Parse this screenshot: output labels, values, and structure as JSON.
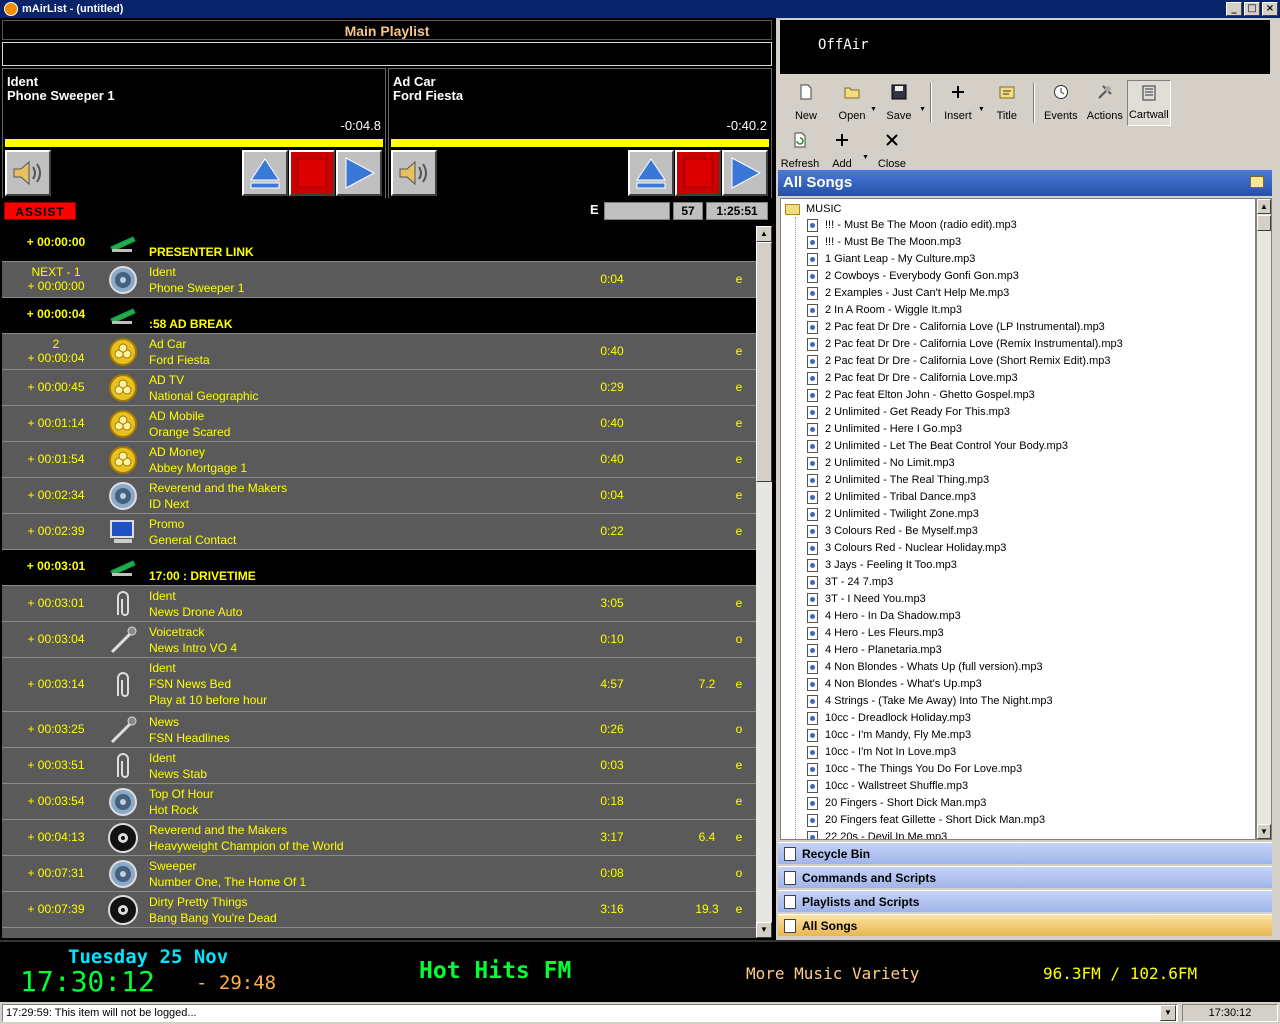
{
  "window": {
    "title": "mAirList - (untitled)"
  },
  "playlist": {
    "title": "Main Playlist"
  },
  "players": [
    {
      "line1": "Ident",
      "line2": "Phone Sweeper 1",
      "remaining": "-0:04.8",
      "progress": 1.0
    },
    {
      "line1": "Ad Car",
      "line2": "Ford Fiesta",
      "remaining": "-0:40.2",
      "progress": 1.0
    }
  ],
  "assist": {
    "label": "ASSIST",
    "e_label": "E",
    "count": "57",
    "duration": "1:25:51"
  },
  "rows": [
    {
      "type": "header",
      "time": "+ 00:00:00",
      "title": "PRESENTER LINK",
      "icon": "stapler-icon"
    },
    {
      "type": "item",
      "time1": "NEXT - 1",
      "time": "+ 00:00:00",
      "line1": "Ident",
      "line2": "Phone Sweeper 1",
      "dur": "0:04",
      "ramp": "",
      "flag": "e",
      "icon": "speaker-icon"
    },
    {
      "type": "header",
      "time": "+ 00:00:04",
      "title": ":58 AD BREAK",
      "icon": "stapler-icon"
    },
    {
      "type": "item",
      "time1": "2",
      "time": "+ 00:00:04",
      "line1": "Ad Car",
      "line2": "Ford Fiesta",
      "dur": "0:40",
      "ramp": "",
      "flag": "e",
      "icon": "coins-icon"
    },
    {
      "type": "item",
      "time": "+ 00:00:45",
      "line1": "AD TV",
      "line2": "National Geographic",
      "dur": "0:29",
      "ramp": "",
      "flag": "e",
      "icon": "coins-icon"
    },
    {
      "type": "item",
      "time": "+ 00:01:14",
      "line1": "AD Mobile",
      "line2": "Orange Scared",
      "dur": "0:40",
      "ramp": "",
      "flag": "e",
      "icon": "coins-icon"
    },
    {
      "type": "item",
      "time": "+ 00:01:54",
      "line1": "AD Money",
      "line2": "Abbey Mortgage 1",
      "dur": "0:40",
      "ramp": "",
      "flag": "e",
      "icon": "coins-icon"
    },
    {
      "type": "item",
      "time": "+ 00:02:34",
      "line1": "Reverend and the Makers",
      "line2": "ID Next",
      "dur": "0:04",
      "ramp": "",
      "flag": "e",
      "icon": "speaker-icon"
    },
    {
      "type": "item",
      "time": "+ 00:02:39",
      "line1": "Promo",
      "line2": "General Contact",
      "dur": "0:22",
      "ramp": "",
      "flag": "e",
      "icon": "monitor-icon"
    },
    {
      "type": "header",
      "time": "+ 00:03:01",
      "title": "17:00 : DRIVETIME",
      "icon": "stapler-icon"
    },
    {
      "type": "item",
      "time": "+ 00:03:01",
      "line1": "Ident",
      "line2": "News Drone Auto",
      "dur": "3:05",
      "ramp": "",
      "flag": "e",
      "icon": "paperclip-icon"
    },
    {
      "type": "item",
      "time": "+ 00:03:04",
      "line1": "Voicetrack",
      "line2": "News Intro VO 4",
      "dur": "0:10",
      "ramp": "",
      "flag": "o",
      "icon": "microphone-icon"
    },
    {
      "type": "item3",
      "time": "+ 00:03:14",
      "line1": "Ident",
      "line2": "FSN News Bed",
      "line3": "Play at 10 before hour",
      "dur": "4:57",
      "ramp": "7.2",
      "flag": "e",
      "icon": "paperclip-icon"
    },
    {
      "type": "item",
      "time": "+ 00:03:25",
      "line1": "News",
      "line2": "FSN Headlines",
      "dur": "0:26",
      "ramp": "",
      "flag": "o",
      "icon": "microphone-icon"
    },
    {
      "type": "item",
      "time": "+ 00:03:51",
      "line1": "Ident",
      "line2": "News Stab",
      "dur": "0:03",
      "ramp": "",
      "flag": "e",
      "icon": "paperclip-icon"
    },
    {
      "type": "item",
      "time": "+ 00:03:54",
      "line1": "Top Of Hour",
      "line2": "Hot Rock",
      "dur": "0:18",
      "ramp": "",
      "flag": "e",
      "icon": "speaker-icon"
    },
    {
      "type": "item",
      "time": "+ 00:04:13",
      "line1": "Reverend and the Makers",
      "line2": "Heavyweight Champion of the World",
      "dur": "3:17",
      "ramp": "6.4",
      "flag": "e",
      "icon": "cd-icon"
    },
    {
      "type": "item",
      "time": "+ 00:07:31",
      "line1": "Sweeper",
      "line2": "Number One, The Home Of 1",
      "dur": "0:08",
      "ramp": "",
      "flag": "o",
      "icon": "speaker-icon"
    },
    {
      "type": "item",
      "time": "+ 00:07:39",
      "line1": "Dirty Pretty Things",
      "line2": "Bang Bang You're Dead",
      "dur": "3:16",
      "ramp": "19.3",
      "flag": "e",
      "icon": "cd-icon"
    }
  ],
  "onair": {
    "label": "OffAir"
  },
  "toolbar1": [
    {
      "label": "New",
      "icon": "new-file-icon",
      "dropdown": false
    },
    {
      "label": "Open",
      "icon": "open-folder-icon",
      "dropdown": true
    },
    {
      "label": "Save",
      "icon": "save-disk-icon",
      "dropdown": true
    },
    {
      "label": "Insert",
      "icon": "insert-plus-icon",
      "dropdown": true
    },
    {
      "label": "Title",
      "icon": "title-icon",
      "dropdown": false
    },
    {
      "label": "Events",
      "icon": "clock-icon",
      "dropdown": false
    },
    {
      "label": "Actions",
      "icon": "tools-icon",
      "dropdown": false
    },
    {
      "label": "Cartwall",
      "icon": "cartwall-icon",
      "dropdown": false
    }
  ],
  "toolbar2": [
    {
      "label": "Refresh",
      "icon": "refresh-icon",
      "dropdown": false
    },
    {
      "label": "Add",
      "icon": "add-plus-icon",
      "dropdown": true
    },
    {
      "label": "Close",
      "icon": "close-x-icon",
      "dropdown": false
    }
  ],
  "songs": {
    "title": "All Songs",
    "folder": "MUSIC",
    "items": [
      "!!! - Must Be The Moon (radio edit).mp3",
      "!!! - Must Be The Moon.mp3",
      "1 Giant Leap - My Culture.mp3",
      "2 Cowboys - Everybody Gonfi Gon.mp3",
      "2 Examples - Just Can't Help Me.mp3",
      "2 In A Room - Wiggle It.mp3",
      "2 Pac feat Dr Dre - California Love (LP Instrumental).mp3",
      "2 Pac feat Dr Dre - California Love (Remix Instrumental).mp3",
      "2 Pac feat Dr Dre - California Love (Short Remix Edit).mp3",
      "2 Pac feat Dr Dre - California Love.mp3",
      "2 Pac feat Elton John - Ghetto Gospel.mp3",
      "2 Unlimited - Get Ready For This.mp3",
      "2 Unlimited - Here I Go.mp3",
      "2 Unlimited - Let The Beat Control Your Body.mp3",
      "2 Unlimited - No Limit.mp3",
      "2 Unlimited - The Real Thing.mp3",
      "2 Unlimited - Tribal Dance.mp3",
      "2 Unlimited - Twilight Zone.mp3",
      "3 Colours Red - Be Myself.mp3",
      "3 Colours Red - Nuclear Holiday.mp3",
      "3 Jays - Feeling It Too.mp3",
      "3T - 24 7.mp3",
      "3T - I Need You.mp3",
      "4 Hero - In Da Shadow.mp3",
      "4 Hero - Les Fleurs.mp3",
      "4 Hero - Planetaria.mp3",
      "4 Non Blondes - Whats Up (full version).mp3",
      "4 Non Blondes - What's Up.mp3",
      "4 Strings - (Take Me Away) Into The Night.mp3",
      "10cc - Dreadlock Holiday.mp3",
      "10cc - I'm Mandy, Fly Me.mp3",
      "10cc - I'm Not In Love.mp3",
      "10cc - The Things You Do For Love.mp3",
      "10cc - Wallstreet Shuffle.mp3",
      "20 Fingers - Short Dick Man.mp3",
      "20 Fingers feat Gillette - Short Dick Man.mp3",
      "22 20s - Devil In Me.mp3"
    ]
  },
  "sections": [
    {
      "label": "Recycle Bin",
      "icon": "recycle-bin-icon",
      "active": false
    },
    {
      "label": "Commands and Scripts",
      "icon": "commands-icon",
      "active": false
    },
    {
      "label": "Playlists and Scripts",
      "icon": "playlists-icon",
      "active": false
    },
    {
      "label": "All Songs",
      "icon": "all-songs-icon",
      "active": true
    }
  ],
  "clock": {
    "date": "Tuesday 25 Nov",
    "time": "17:30:12",
    "remaining": "- 29:48",
    "station": "Hot Hits FM",
    "slogan": "More Music Variety",
    "frequency": "96.3FM / 102.6FM"
  },
  "status": {
    "message": "17:29:59: This item will not be logged...",
    "time": "17:30:12"
  }
}
